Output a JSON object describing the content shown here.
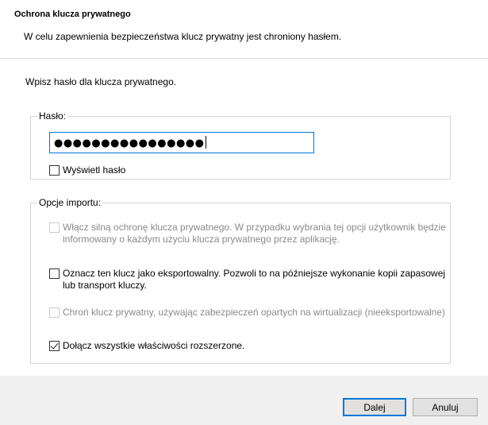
{
  "header": {
    "title": "Ochrona klucza prywatnego",
    "subtitle": "W celu zapewnienia bezpieczeństwa klucz prywatny jest chroniony hasłem."
  },
  "prompt": "Wpisz hasło dla klucza prywatnego.",
  "password_group": {
    "legend": "Hasło:",
    "value_masked": "●●●●●●●●●●●●●●●●",
    "show_password": {
      "label": "Wyświetl hasło",
      "checked": false,
      "enabled": true
    }
  },
  "import_group": {
    "legend": "Opcje importu:",
    "options": [
      {
        "label": "Włącz silną ochronę klucza prywatnego. W przypadku wybrania tej opcji użytkownik będzie informowany o każdym użyciu klucza prywatnego przez aplikację.",
        "checked": false,
        "enabled": false
      },
      {
        "label": "Oznacz ten klucz jako eksportowalny. Pozwoli to na późniejsze wykonanie kopii zapasowej lub transport kluczy.",
        "checked": false,
        "enabled": true
      },
      {
        "label": "Chroń klucz prywatny, używając zabezpieczeń opartych na wirtualizacji (nieeksportowalne)",
        "checked": false,
        "enabled": false
      },
      {
        "label": "Dołącz wszystkie właściwości rozszerzone.",
        "checked": true,
        "enabled": true
      }
    ]
  },
  "footer": {
    "next_label": "Dalej",
    "cancel_label": "Anuluj"
  }
}
